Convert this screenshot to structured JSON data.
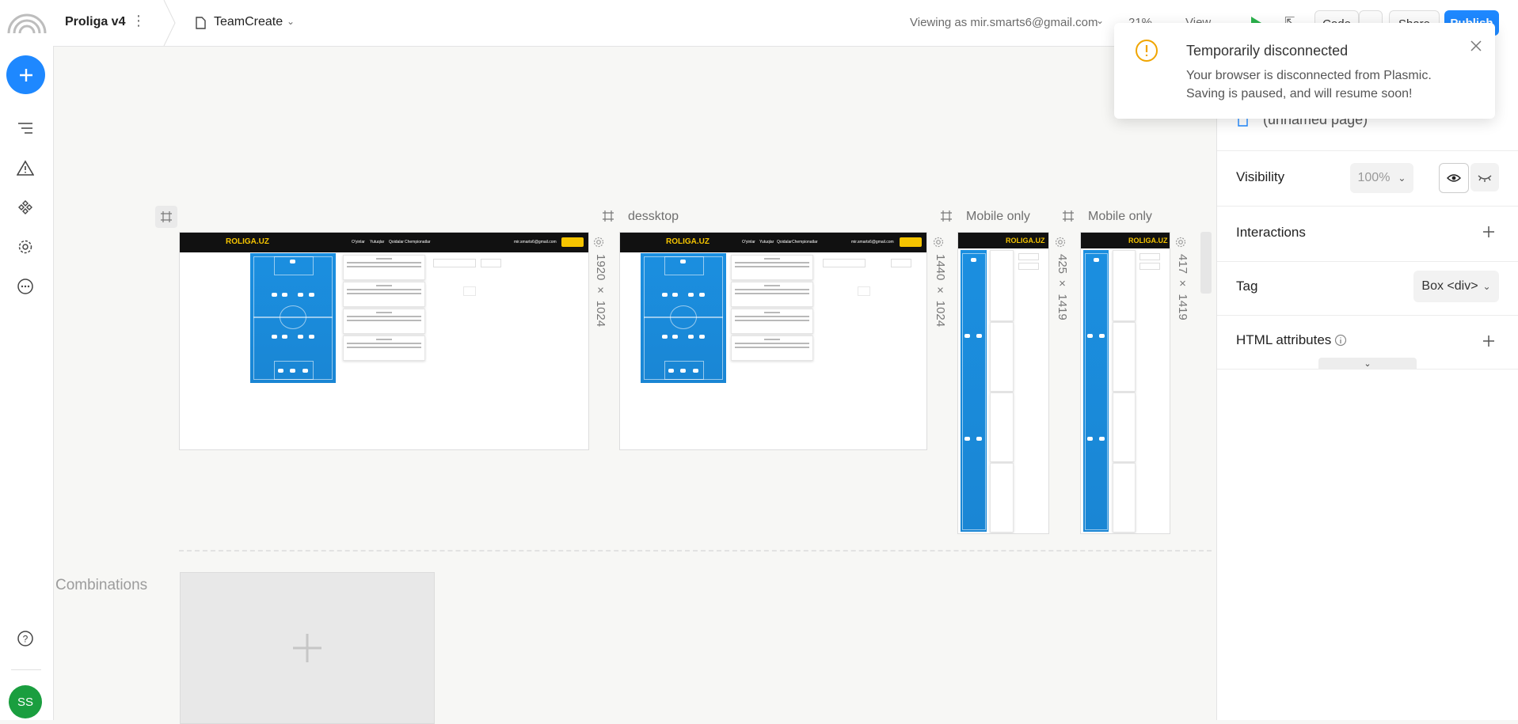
{
  "app": {
    "project_name": "Proliga v4",
    "page_name": "TeamCreate",
    "viewing_as": "Viewing as mir.smarts6@gmail.com",
    "zoom": "21%",
    "view_label": "View",
    "code_label": "Code",
    "share_label": "Share",
    "publish_label": "Publish"
  },
  "toast": {
    "title": "Temporarily disconnected",
    "body_line1": "Your browser is disconnected from Plasmic.",
    "body_line2": "Saving is paused, and will resume soon!"
  },
  "panel": {
    "page_title": "(unnamed page)",
    "visibility_label": "Visibility",
    "visibility_value": "100%",
    "interactions_label": "Interactions",
    "tag_label": "Tag",
    "tag_value": "Box <div>",
    "html_attr_label": "HTML attributes"
  },
  "canvas": {
    "frames": [
      {
        "label": "",
        "size": "1920 × 1024"
      },
      {
        "label": "dessktop",
        "size": "1440 × 1024"
      },
      {
        "label": "Mobile only",
        "size": "425 × 1419"
      },
      {
        "label": "Mobile only",
        "size": "417 × 1419"
      }
    ],
    "combinations_label": "Combinations",
    "site_logo": "ROLIGA.UZ",
    "site_nav": [
      "O'yinlar",
      "Yutuqlar",
      "Qoidalar",
      "Chempionatlar"
    ],
    "site_email": "mir.smarts6@gmail.com",
    "card_title": "qoida"
  },
  "user": {
    "initials": "SS"
  },
  "colors": {
    "accent": "#1e88ff",
    "avatar": "#1a9e3f",
    "warning": "#f0a500",
    "pitch": "#1a86d4"
  }
}
